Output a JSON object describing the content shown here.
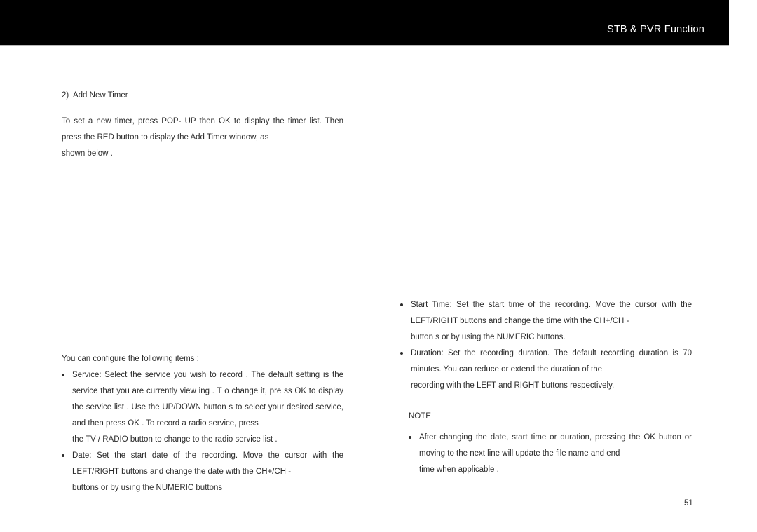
{
  "header": {
    "title": "STB & PVR Function",
    "background_color": "#000000",
    "text_color": "#ffffff"
  },
  "page": {
    "number": "51",
    "background_color": "#ffffff",
    "text_color": "#2b2b2b"
  },
  "left_column": {
    "heading": "2)  Add New Timer",
    "intro_paragraph": "To  set  a  new  timer,   press  POP- UP  then   OK  to display the timer list. Then  press  the  RED  button to display  the  Add  Timer  window,  as",
    "intro_paragraph_lastline": "shown below  .",
    "configure_line": "You can configure the following items           ;",
    "items": [
      {
        "text": "Service: Select the service you wish to record         .   The default   setting  is the service that you are        currently view  ing .  T o change it, pre    ss OK  to display  the  service      list .   Use  the  UP/DOWN     button s to select your desired service, and then        press  OK .   To record a radio service, press",
        "tail": "the  TV /  RADIO    button to change      to the radio service list     ."
      },
      {
        "text": "Date: Set the start date of the          recording.    Move  the  cursor with the LEFT/RIGHT      buttons  and  change       the   date  with    the   CH+/CH   -",
        "tail": "buttons  or by using   the  NUMERIC   buttons"
      }
    ]
  },
  "right_column": {
    "items": [
      {
        "text": "Start  Time: Set the start time of the recording.           Move  the  cursor with the  LEFT/RIGHT     buttons and change the      time with the    CH+/CH   -",
        "tail": "button  s or by using   the  NUMERIC   buttons."
      },
      {
        "text": "Duration: Set the recording duration.          The default   recording duration is  70   minutes.     You  can  reduce  or  extend  the  duration  of  the",
        "tail": "recording with    the LEFT and RIGHT   buttons respectively."
      }
    ]
  },
  "note": {
    "heading": "NOTE",
    "items": [
      {
        "text": "After  changing  the  date,  start  time  or  duration,  pressing  the                OK button or moving to the next line will update the file name and end",
        "tail": "time when applicable     ."
      }
    ]
  }
}
